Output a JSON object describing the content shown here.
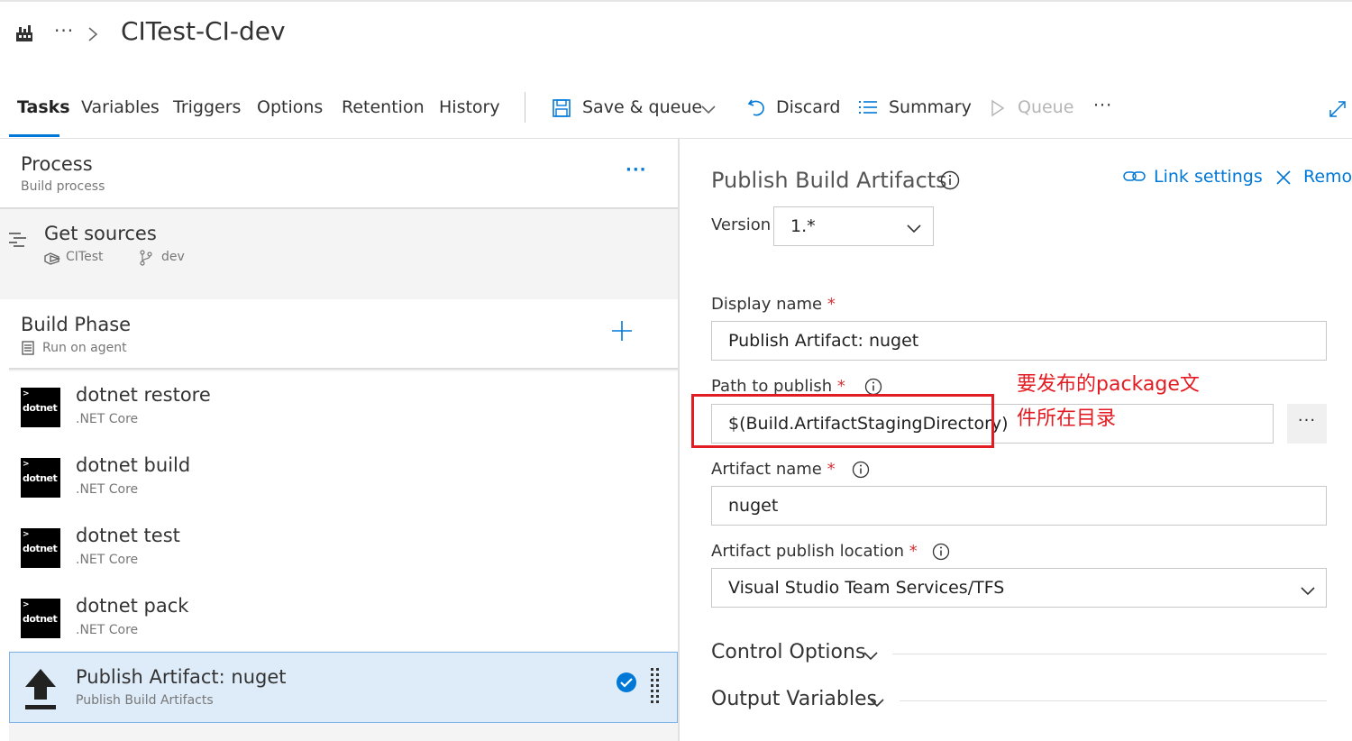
{
  "header": {
    "ellipsis": "···",
    "title": "CITest-CI-dev"
  },
  "tabs": [
    {
      "label": "Tasks",
      "active": true
    },
    {
      "label": "Variables"
    },
    {
      "label": "Triggers"
    },
    {
      "label": "Options"
    },
    {
      "label": "Retention"
    },
    {
      "label": "History"
    }
  ],
  "toolbar": {
    "save_queue": "Save & queue",
    "discard": "Discard",
    "summary": "Summary",
    "queue": "Queue",
    "more": "···"
  },
  "process": {
    "title": "Process",
    "subtitle": "Build process",
    "more": "···"
  },
  "get_sources": {
    "title": "Get sources",
    "repo": "CITest",
    "branch": "dev"
  },
  "phase": {
    "title": "Build Phase",
    "subtitle": "Run on agent"
  },
  "tasks": [
    {
      "name": "dotnet restore",
      "category": ".NET Core",
      "logo": "dotnet"
    },
    {
      "name": "dotnet build",
      "category": ".NET Core",
      "logo": "dotnet"
    },
    {
      "name": "dotnet test",
      "category": ".NET Core",
      "logo": "dotnet"
    },
    {
      "name": "dotnet pack",
      "category": ".NET Core",
      "logo": "dotnet"
    }
  ],
  "selected_task": {
    "name": "Publish Artifact: nuget",
    "category": "Publish Build Artifacts"
  },
  "details": {
    "title": "Publish Build Artifacts",
    "link_settings": "Link settings",
    "remove": "Remov",
    "version_label": "Version",
    "version_value": "1.*",
    "display_name_label": "Display name",
    "display_name_value": "Publish Artifact: nuget",
    "path_label": "Path to publish",
    "path_value": "$(Build.ArtifactStagingDirectory)",
    "path_browse": "···",
    "artifact_name_label": "Artifact name",
    "artifact_name_value": "nuget",
    "location_label": "Artifact publish location",
    "location_value": "Visual Studio Team Services/TFS",
    "required_mark": "*",
    "control_options": "Control Options",
    "output_variables": "Output Variables"
  },
  "annotation": {
    "text": "要发布的package文件所在目录",
    "color": "#e31c23"
  },
  "colors": {
    "accent": "#0078d7",
    "selected_bg": "#deecf9",
    "required": "#d13438"
  }
}
